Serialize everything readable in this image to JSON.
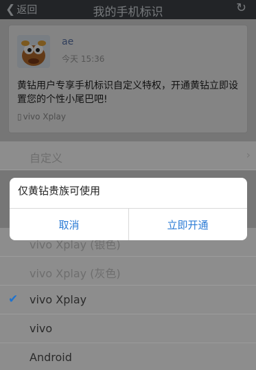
{
  "navbar": {
    "back_label": "返回",
    "title": "我的手机标识"
  },
  "card": {
    "username": "ae",
    "time": "今天 15:36",
    "message": "黄钻用户专享手机标识自定义特权，开通黄钻立即设置您的个性小尾巴吧!",
    "device": "vivo Xplay"
  },
  "options": [
    {
      "label": "自定义"
    },
    {
      "label": "vivo Xplay (银色)"
    },
    {
      "label": "vivo Xplay (灰色)"
    },
    {
      "label": "vivo Xplay"
    },
    {
      "label": "vivo"
    },
    {
      "label": "Android"
    }
  ],
  "dialog": {
    "title": "仅黄钻贵族可使用",
    "cancel_label": "取消",
    "confirm_label": "立即开通"
  }
}
